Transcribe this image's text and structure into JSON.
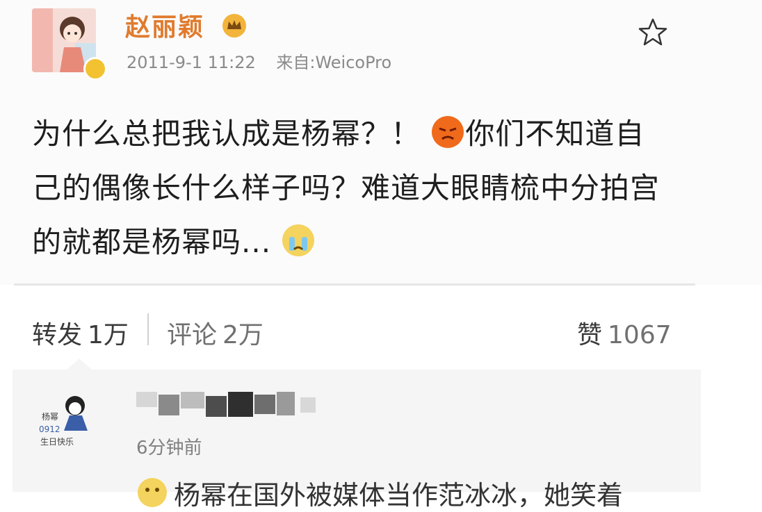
{
  "post": {
    "username": "赵丽颖",
    "date": "2011-9-1 11:22",
    "source": "来自:WeicoPro",
    "text_1": "为什么总把我认成是杨幂？！",
    "text_2": "你们不知道自己的偶像长什么样子吗？难道大眼睛梳中分拍宫的就都是杨幂吗...",
    "emoji_1": "angry-face-icon",
    "emoji_2": "crying-face-icon"
  },
  "actions": {
    "repost_label": "转发",
    "repost_count": "1万",
    "comment_label": "评论",
    "comment_count": "2万",
    "like_label": "赞",
    "like_count": "1067"
  },
  "comment": {
    "time": "6分钟前",
    "text": "杨幂在国外被媒体当作范冰冰，她笑着"
  },
  "colors": {
    "username": "#e07b2e",
    "muted": "#8a8a8a",
    "comment_bg": "#f5f5f5"
  }
}
